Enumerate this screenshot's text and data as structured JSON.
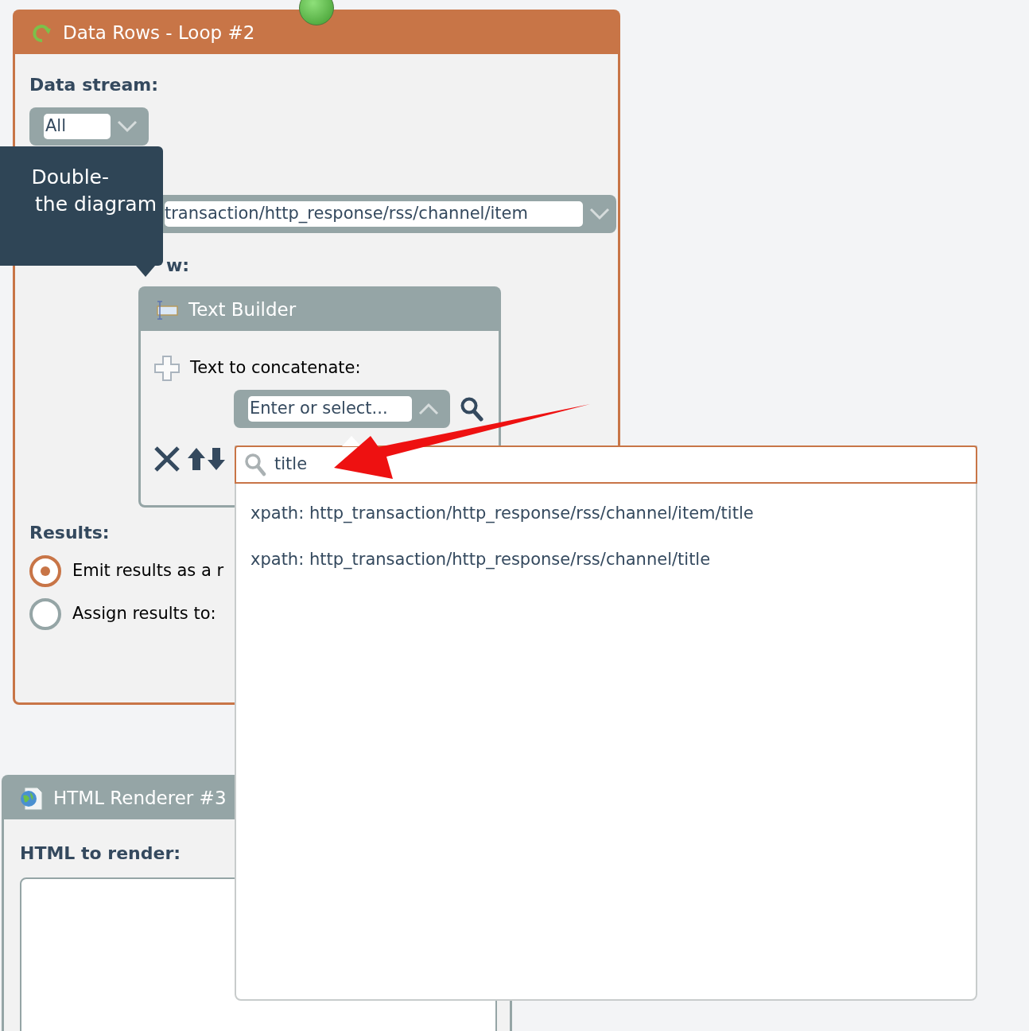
{
  "loop_node": {
    "title": "Data Rows - Loop #2",
    "data_stream_label": "Data stream:",
    "data_stream_value": "All",
    "path_value": "transaction/http_response/rss/channel/item",
    "for_each_label": "w:",
    "results_label": "Results:",
    "results_options": [
      {
        "label": "Emit results as a r",
        "selected": true
      },
      {
        "label": "Assign results to:",
        "selected": false
      }
    ]
  },
  "tooltip": {
    "lines": [
      "Double-",
      "the diagram"
    ]
  },
  "text_builder": {
    "title": "Text Builder",
    "concat_label": "Text to concatenate:",
    "select_placeholder": "Enter or select..."
  },
  "html_renderer": {
    "title": "HTML Renderer #3",
    "html_label": "HTML to render:"
  },
  "dropdown": {
    "search_value": "title",
    "options": [
      "xpath: http_transaction/http_response/rss/channel/item/title",
      "xpath: http_transaction/http_response/rss/channel/title"
    ]
  }
}
